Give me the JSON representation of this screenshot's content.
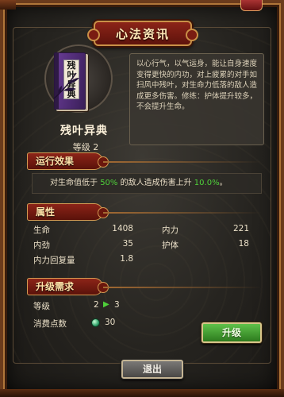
{
  "title": "心法资讯",
  "skill": {
    "name": "残叶异典",
    "level_label": "等级 2",
    "book_label": "残叶异典",
    "description": "以心行气，以气运身，能让自身速度变得更快的内功，对上疲累的对手如扫风中残叶，对生命力低落的敌人造成更多伤害。修练：护体提升较多，不会提升生命。"
  },
  "effect": {
    "header": "运行效果",
    "text_prefix": "对生命值低于",
    "threshold": "50%",
    "text_middle": "的敌人造成伤害上升",
    "bonus": "10.0%",
    "text_suffix": "。"
  },
  "attributes": {
    "header": "属性",
    "items": [
      {
        "label": "生命",
        "value": "1408"
      },
      {
        "label": "内力",
        "value": "221"
      },
      {
        "label": "内劲",
        "value": "35"
      },
      {
        "label": "护体",
        "value": "18"
      },
      {
        "label": "内力回复量",
        "value": "1.8"
      }
    ]
  },
  "requirements": {
    "header": "升级需求",
    "level_label": "等级",
    "level_from": "2",
    "level_arrow": "▶",
    "level_to": "3",
    "cost_label": "消费点数",
    "cost_value": "30"
  },
  "buttons": {
    "upgrade": "升级",
    "exit": "退出"
  },
  "colors": {
    "highlight_green": "#4fd03a",
    "header_red": "#8c2418",
    "gold_border": "#d39a52"
  }
}
